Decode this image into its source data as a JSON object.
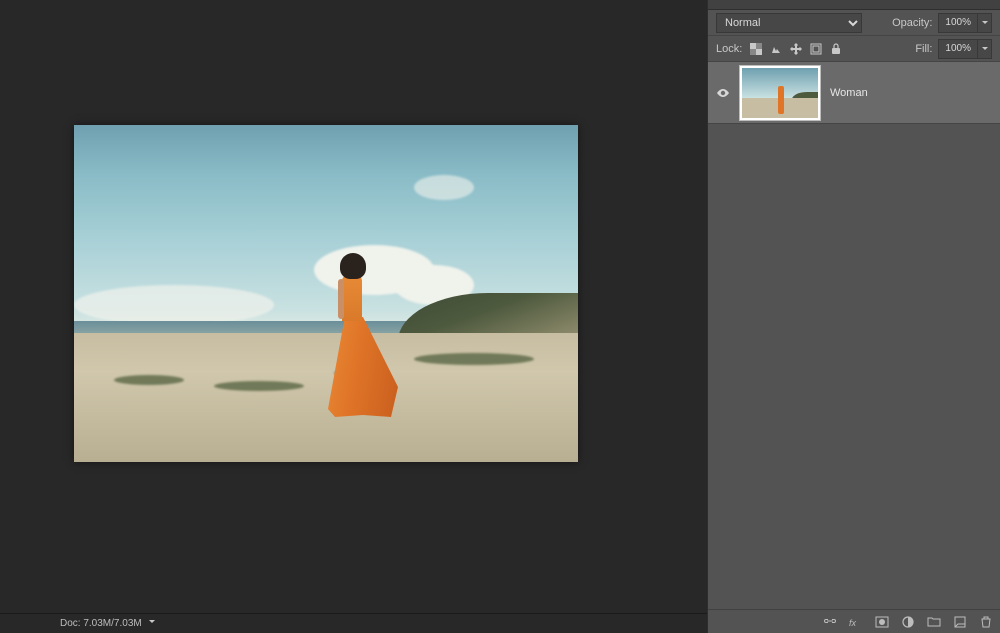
{
  "canvas": {
    "status_text": "Doc: 7.03M/7.03M"
  },
  "panel": {
    "blend_mode": "Normal",
    "opacity_label": "Opacity:",
    "opacity_value": "100%",
    "lock_label": "Lock:",
    "fill_label": "Fill:",
    "fill_value": "100%"
  },
  "layers": [
    {
      "name": "Woman",
      "visible": true
    }
  ],
  "icons": {
    "lock_pixels": "lock-transparent-pixels",
    "lock_brush": "lock-image-pixels",
    "lock_move": "lock-position",
    "lock_artboard": "prevent-artboard-nesting",
    "lock_all": "lock-all",
    "link": "link-layers",
    "fx": "layer-effects",
    "mask": "add-mask",
    "adjust": "adjustment-layer",
    "group": "new-group",
    "new": "new-layer",
    "trash": "delete-layer"
  }
}
